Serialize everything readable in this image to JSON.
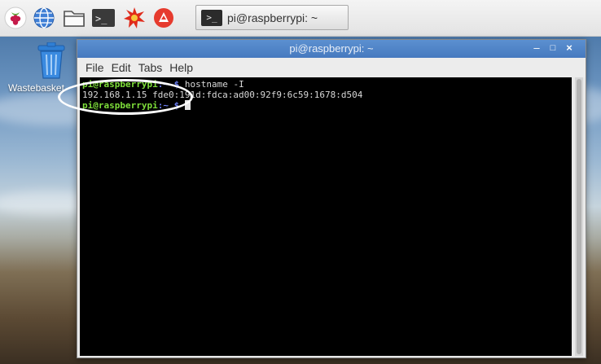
{
  "taskbar": {
    "launchers": [
      "raspberry-menu-icon",
      "globe-icon",
      "file-manager-icon",
      "terminal-icon",
      "mathematica-icon",
      "wolfram-icon"
    ],
    "task_button_label": "pi@raspberrypi: ~",
    "task_button_glyph": ">_"
  },
  "desktop": {
    "wastebasket_label": "Wastebasket"
  },
  "window": {
    "title": "pi@raspberrypi: ~",
    "controls": {
      "minimize": "–",
      "maximize": "□",
      "close": "×"
    },
    "menu": [
      "File",
      "Edit",
      "Tabs",
      "Help"
    ]
  },
  "terminal": {
    "line1_prompt": "pi@raspberrypi",
    "line1_path": ":~ $",
    "line1_command": " hostname -I",
    "line2_output": "192.168.1.15 fde0:191d:fdca:ad00:92f9:6c59:1678:d504",
    "line3_prompt": "pi@raspberrypi",
    "line3_path": ":~ $"
  },
  "colors": {
    "titlebar": "#4f86c9",
    "prompt_green": "#7ede3a",
    "path_blue": "#6a7ef0"
  }
}
